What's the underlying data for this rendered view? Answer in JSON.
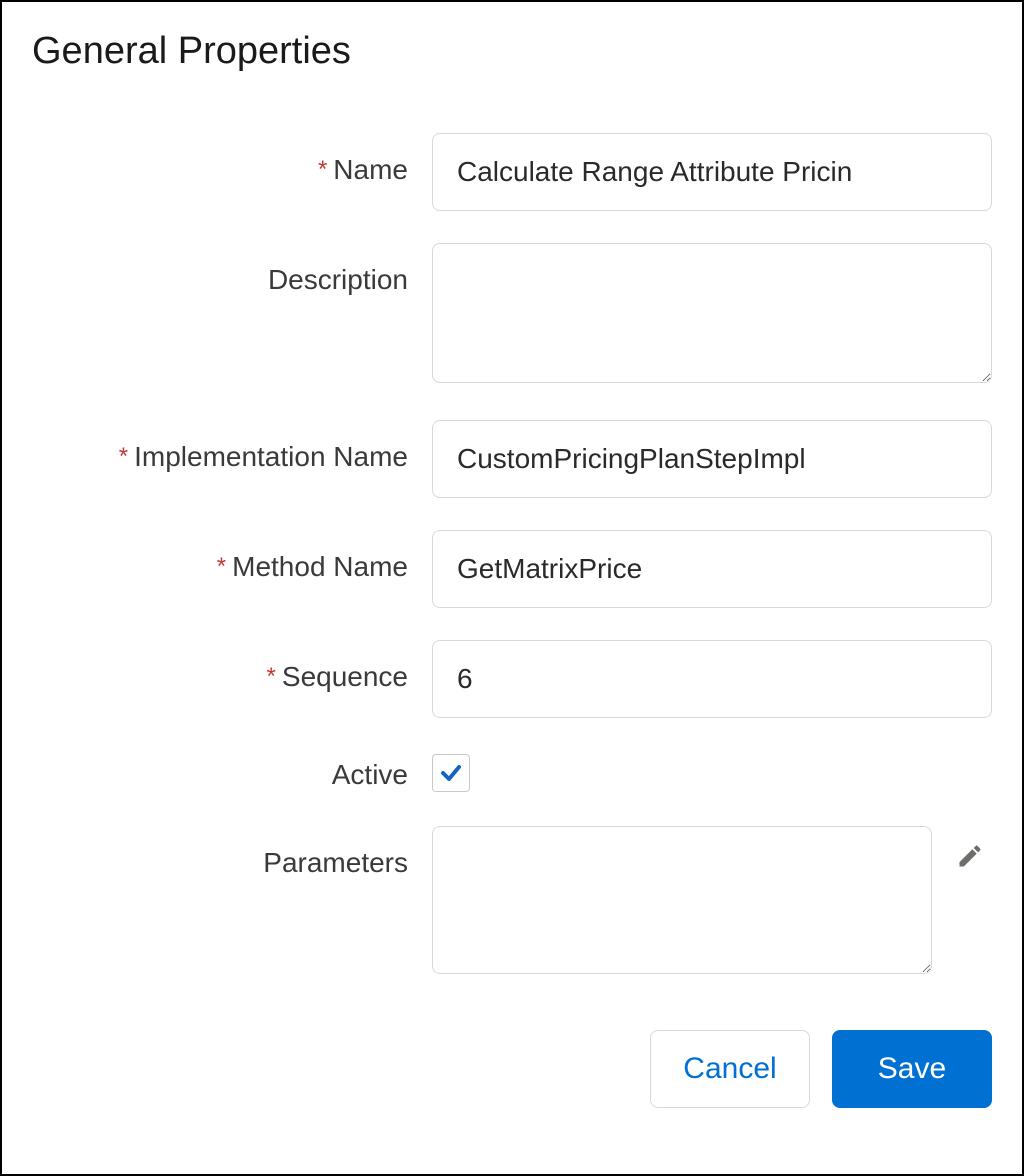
{
  "title": "General Properties",
  "fields": {
    "name": {
      "label": "Name",
      "required": true,
      "value": "Calculate Range Attribute Pricin"
    },
    "description": {
      "label": "Description",
      "required": false,
      "value": ""
    },
    "implementation_name": {
      "label": "Implementation Name",
      "required": true,
      "value": "CustomPricingPlanStepImpl"
    },
    "method_name": {
      "label": "Method Name",
      "required": true,
      "value": "GetMatrixPrice"
    },
    "sequence": {
      "label": "Sequence",
      "required": true,
      "value": "6"
    },
    "active": {
      "label": "Active",
      "required": false,
      "checked": true
    },
    "parameters": {
      "label": "Parameters",
      "required": false,
      "value": ""
    }
  },
  "buttons": {
    "cancel": "Cancel",
    "save": "Save"
  },
  "required_marker": "*"
}
